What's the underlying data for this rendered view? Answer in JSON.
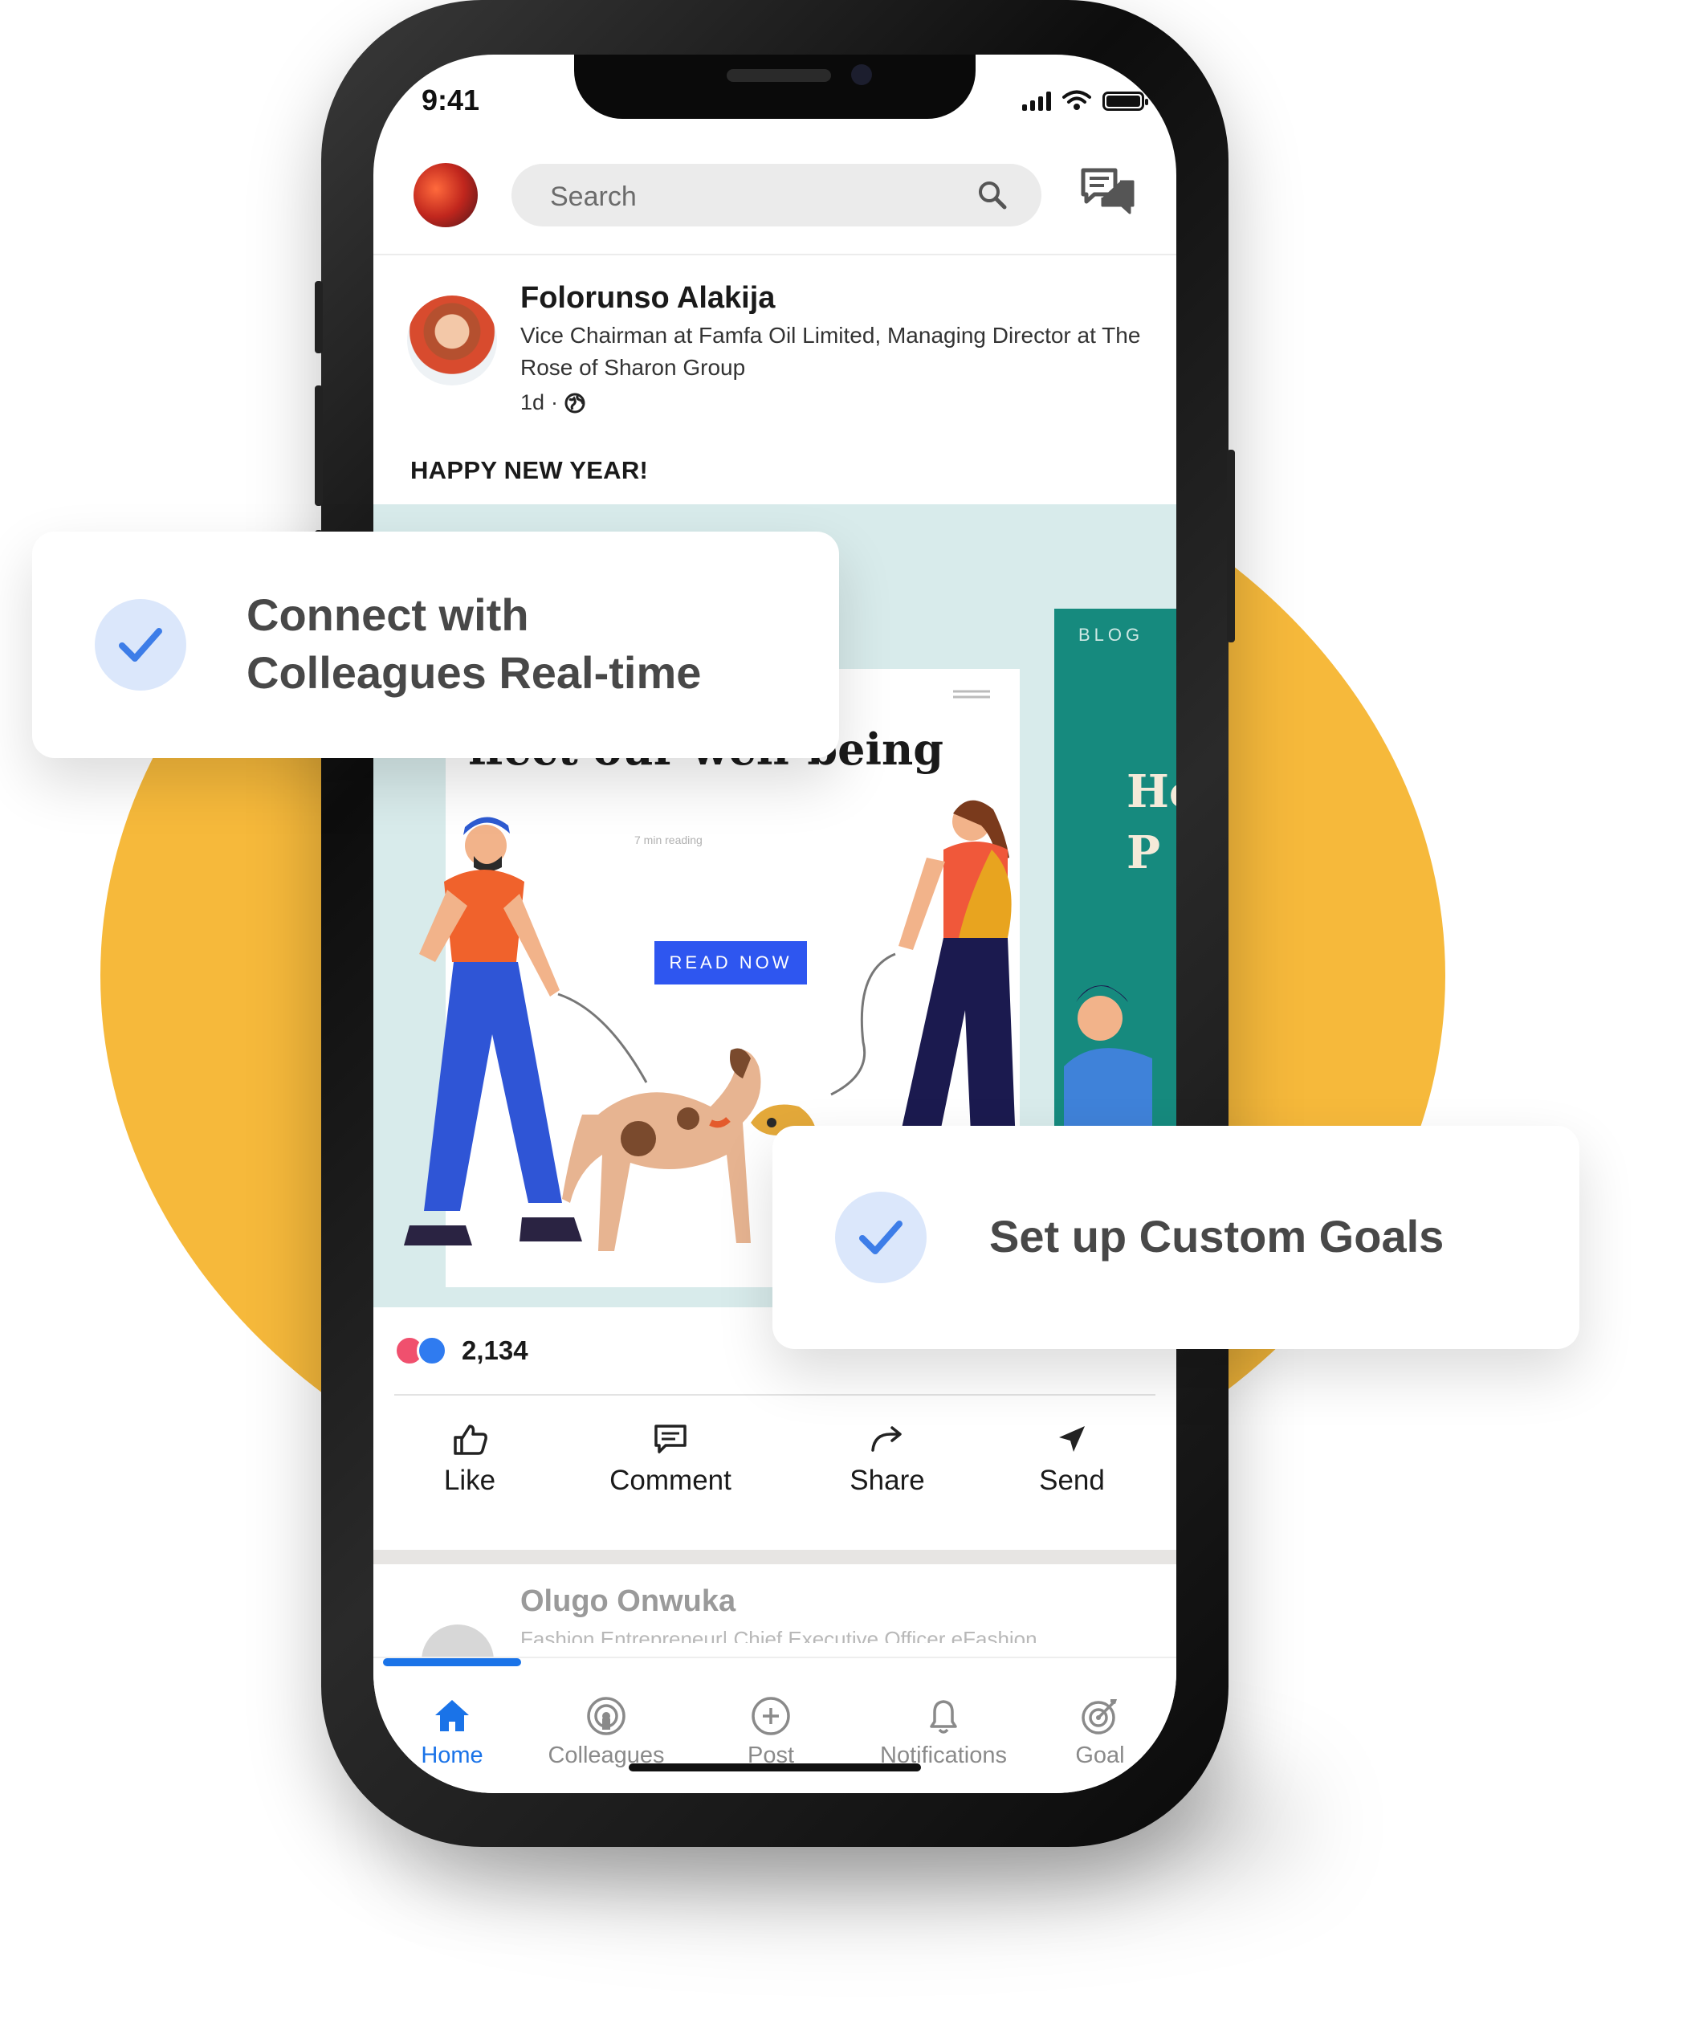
{
  "status_bar": {
    "time": "9:41"
  },
  "search": {
    "placeholder": "Search"
  },
  "post": {
    "author": "Folorunso Alakija",
    "headline": "Vice Chairman at Famfa Oil Limited, Managing Director at The Rose of Sharon Group",
    "age": "1d",
    "separator": "·",
    "text": "HAPPY NEW YEAR!",
    "image": {
      "title": "ffect our well-being",
      "reading_time": "7 min reading",
      "button": "READ NOW",
      "side_card_label": "BLOG",
      "side_card_text": "Ho P"
    },
    "reaction_count": "2,134",
    "actions": [
      {
        "label": "Like",
        "icon": "thumbs-up-icon"
      },
      {
        "label": "Comment",
        "icon": "comment-icon"
      },
      {
        "label": "Share",
        "icon": "share-arrow-icon"
      },
      {
        "label": "Send",
        "icon": "send-icon"
      }
    ]
  },
  "next_post": {
    "author": "Olugo Onwuka",
    "headline": "Fashion Entrepreneur| Chief Executive Officer eFashion"
  },
  "tabs": [
    {
      "label": "Home",
      "icon": "home-icon",
      "active": true
    },
    {
      "label": "Colleagues",
      "icon": "colleagues-icon",
      "active": false
    },
    {
      "label": "Post",
      "icon": "add-post-icon",
      "active": false
    },
    {
      "label": "Notifications",
      "icon": "bell-icon",
      "active": false
    },
    {
      "label": "Goal",
      "icon": "target-icon",
      "active": false
    }
  ],
  "callouts": [
    {
      "text_line1": "Connect with",
      "text_line2": "Colleagues Real-time"
    },
    {
      "text": "Set up Custom Goals"
    }
  ],
  "colors": {
    "accent": "#1a73e8",
    "blob": "#f6b93b",
    "check_bg": "#dbe7fb",
    "read_button": "#2e56f0",
    "teal_card": "#168a7e"
  }
}
